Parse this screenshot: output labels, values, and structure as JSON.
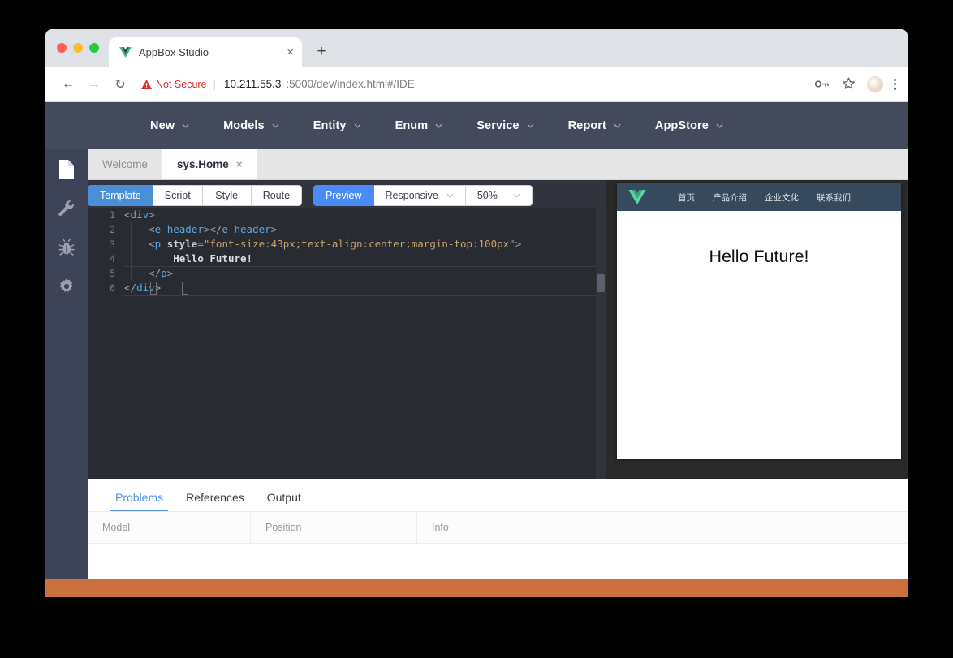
{
  "browser": {
    "tab": {
      "title": "AppBox Studio",
      "close_label": "×",
      "favicon": "vue-logo-icon"
    },
    "newtab_label": "+",
    "nav": {
      "back": "←",
      "forward": "→",
      "reload": "↻"
    },
    "omnibox": {
      "security_label": "Not Secure",
      "separator": "|",
      "url_host": "10.211.55.3",
      "url_path": ":5000/dev/index.html#/IDE"
    },
    "actions": {
      "key": "key-icon",
      "bookmark": "star-icon",
      "profile": "avatar-icon",
      "menu": "kebab-menu-icon"
    }
  },
  "menubar": {
    "items": [
      {
        "label": "New"
      },
      {
        "label": "Models"
      },
      {
        "label": "Entity"
      },
      {
        "label": "Enum"
      },
      {
        "label": "Service"
      },
      {
        "label": "Report"
      },
      {
        "label": "AppStore"
      }
    ]
  },
  "rail": {
    "items": [
      {
        "icon": "file-icon",
        "name": "explorer"
      },
      {
        "icon": "wrench-icon",
        "name": "tools"
      },
      {
        "icon": "bug-icon",
        "name": "debug"
      },
      {
        "icon": "gear-icon",
        "name": "settings"
      }
    ]
  },
  "editor_tabs": {
    "items": [
      {
        "label": "Welcome",
        "active": false,
        "closable": false
      },
      {
        "label": "sys.Home",
        "active": true,
        "closable": true,
        "close_label": "×"
      }
    ]
  },
  "toolbar": {
    "view_modes": [
      {
        "label": "Template",
        "active": true
      },
      {
        "label": "Script",
        "active": false
      },
      {
        "label": "Style",
        "active": false
      },
      {
        "label": "Route",
        "active": false
      }
    ],
    "preview_label": "Preview",
    "layout_select": {
      "value": "Responsive"
    },
    "zoom_select": {
      "value": "50%"
    }
  },
  "code": {
    "language": "html",
    "lines": [
      {
        "n": "1",
        "text": "<div>"
      },
      {
        "n": "2",
        "text": "    <e-header></e-header>"
      },
      {
        "n": "3",
        "text": "    <p style=\"font-size:43px;text-align:center;margin-top:100px\">"
      },
      {
        "n": "4",
        "text": "        Hello Future!"
      },
      {
        "n": "5",
        "text": "    </p>"
      },
      {
        "n": "6",
        "text": "</div>"
      }
    ]
  },
  "preview": {
    "logo": "vue-logo-icon",
    "nav": [
      {
        "label": "首页"
      },
      {
        "label": "产品介绍"
      },
      {
        "label": "企业文化"
      },
      {
        "label": "联系我们"
      }
    ],
    "content": {
      "heading": "Hello Future!"
    }
  },
  "bottom_panel": {
    "tabs": [
      {
        "label": "Problems",
        "active": true
      },
      {
        "label": "References",
        "active": false
      },
      {
        "label": "Output",
        "active": false
      }
    ],
    "columns": [
      {
        "label": "Model"
      },
      {
        "label": "Position"
      },
      {
        "label": "Info"
      }
    ],
    "rows": []
  },
  "colors": {
    "menubar_bg": "#434a5c",
    "rail_bg": "#3d4457",
    "editor_bg": "#282c32",
    "accent_blue": "#4a8cf7",
    "tab_active_blue": "#4a90d9",
    "preview_header_bg": "#37495c",
    "status_orange": "#cd703f",
    "vue_green": "#42b883",
    "not_secure_red": "#d93025"
  }
}
